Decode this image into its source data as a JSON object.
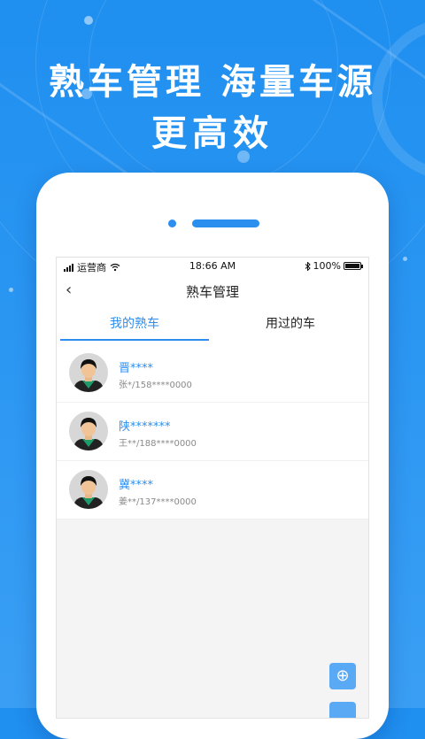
{
  "headline": {
    "line1": "熟车管理 海量车源",
    "line2": "更高效"
  },
  "status_bar": {
    "carrier": "运营商",
    "time": "18:66 AM",
    "battery_text": "100%",
    "battery_level": 1.0
  },
  "nav": {
    "back_icon": "chevron-left-icon",
    "title": "熟车管理"
  },
  "tabs": [
    {
      "label": "我的熟车",
      "active": true
    },
    {
      "label": "用过的车",
      "active": false
    }
  ],
  "vehicles": [
    {
      "plate": "晋****",
      "owner": "张*/158****0000"
    },
    {
      "plate": "陕*******",
      "owner": "王**/188****0000"
    },
    {
      "plate": "冀****",
      "owner": "姜**/137****0000"
    }
  ],
  "fab": {
    "icon": "add-circle-icon",
    "symbol": "⊕"
  },
  "colors": {
    "accent": "#2d8ef0",
    "background": "#1f8ff0"
  }
}
